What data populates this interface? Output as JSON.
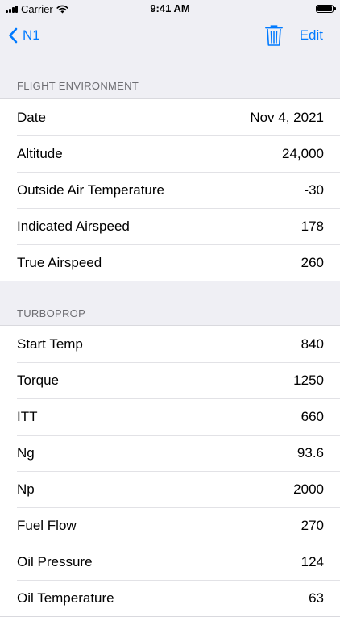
{
  "status_bar": {
    "carrier": "Carrier",
    "time": "9:41 AM"
  },
  "nav": {
    "back_label": "N1",
    "edit_label": "Edit",
    "accent_color": "#007AFF"
  },
  "sections": [
    {
      "header": "FLIGHT ENVIRONMENT",
      "rows": [
        {
          "label": "Date",
          "value": "Nov 4, 2021"
        },
        {
          "label": "Altitude",
          "value": "24,000"
        },
        {
          "label": "Outside Air Temperature",
          "value": "-30"
        },
        {
          "label": "Indicated Airspeed",
          "value": "178"
        },
        {
          "label": "True Airspeed",
          "value": "260"
        }
      ]
    },
    {
      "header": "TURBOPROP",
      "rows": [
        {
          "label": "Start Temp",
          "value": "840"
        },
        {
          "label": "Torque",
          "value": "1250"
        },
        {
          "label": "ITT",
          "value": "660"
        },
        {
          "label": "Ng",
          "value": "93.6"
        },
        {
          "label": "Np",
          "value": "2000"
        },
        {
          "label": "Fuel Flow",
          "value": "270"
        },
        {
          "label": "Oil Pressure",
          "value": "124"
        },
        {
          "label": "Oil Temperature",
          "value": "63"
        }
      ]
    }
  ]
}
